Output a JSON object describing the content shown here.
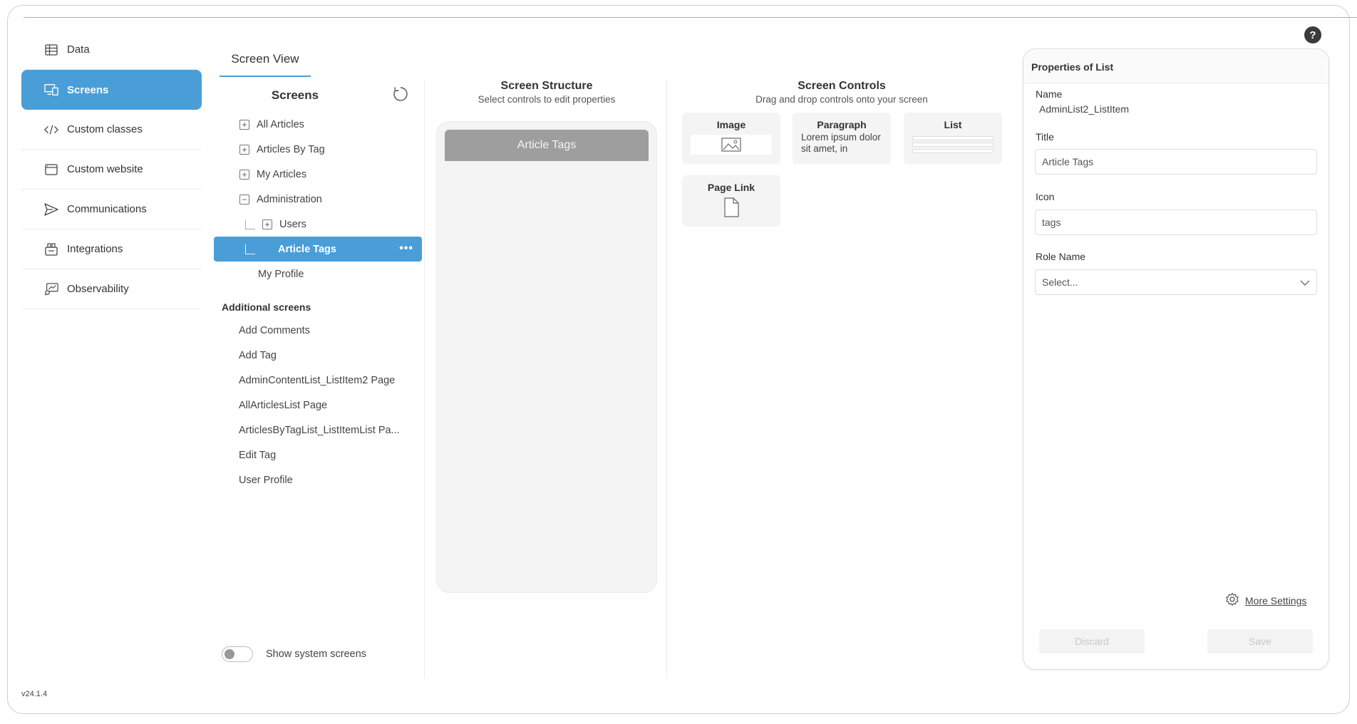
{
  "sidebar": {
    "items": [
      {
        "label": "Data",
        "icon": "table-icon"
      },
      {
        "label": "Screens",
        "icon": "screens-icon",
        "active": true
      },
      {
        "label": "Custom classes",
        "icon": "code-icon"
      },
      {
        "label": "Custom website",
        "icon": "browser-icon"
      },
      {
        "label": "Communications",
        "icon": "send-icon"
      },
      {
        "label": "Integrations",
        "icon": "integrations-icon"
      },
      {
        "label": "Observability",
        "icon": "observability-icon"
      }
    ],
    "version": "v24.1.4"
  },
  "header": {
    "tab": "Screen View",
    "help": "?"
  },
  "screens": {
    "title": "Screens",
    "tree": [
      {
        "label": "All Articles"
      },
      {
        "label": "Articles By Tag"
      },
      {
        "label": "My Articles"
      },
      {
        "label": "Administration"
      },
      {
        "label": "Users"
      },
      {
        "label": "Article Tags",
        "more": "•••"
      },
      {
        "label": "My Profile"
      }
    ],
    "additional_title": "Additional screens",
    "additional": [
      "Add Comments",
      "Add Tag",
      "AdminContentList_ListItem2 Page",
      "AllArticlesList Page",
      "ArticlesByTagList_ListItemList Pa...",
      "Edit Tag",
      "User Profile"
    ],
    "show_system_label": "Show system screens"
  },
  "structure": {
    "title": "Screen Structure",
    "subtitle": "Select controls to edit properties",
    "header_text": "Article Tags"
  },
  "controls": {
    "title": "Screen Controls",
    "subtitle": "Drag and drop controls onto your screen",
    "items": {
      "image": "Image",
      "paragraph": "Paragraph",
      "paragraph_text": "Lorem ipsum dolor sit amet, in",
      "list": "List",
      "page_link": "Page Link"
    }
  },
  "properties": {
    "header": "Properties of List",
    "name_label": "Name",
    "name_value": "AdminList2_ListItem",
    "title_label": "Title",
    "title_value": "Article Tags",
    "icon_label": "Icon",
    "icon_value": "tags",
    "role_label": "Role Name",
    "role_placeholder": "Select...",
    "more_settings": "More Settings",
    "discard": "Discard",
    "save": "Save"
  },
  "colors": {
    "accent": "#4a9ed8",
    "phone_header": "#9e9e9e",
    "top_line": "#8dc68f"
  }
}
